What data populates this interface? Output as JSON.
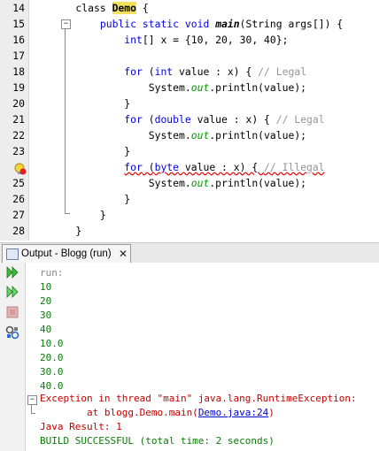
{
  "editor": {
    "lines": [
      {
        "n": "14",
        "parts": [
          [
            "",
            "    class "
          ],
          [
            "hl",
            "Demo"
          ],
          [
            "",
            " {"
          ]
        ]
      },
      {
        "n": "15",
        "parts": [
          [
            "",
            "        "
          ],
          [
            "kw",
            "public static void "
          ],
          [
            "b",
            "main"
          ],
          [
            "",
            "(String args[]) {"
          ]
        ]
      },
      {
        "n": "16",
        "parts": [
          [
            "",
            "            "
          ],
          [
            "kw",
            "int"
          ],
          [
            "",
            "[] x = {10, 20, 30, 40};"
          ]
        ]
      },
      {
        "n": "17",
        "parts": [
          [
            "",
            ""
          ]
        ]
      },
      {
        "n": "18",
        "parts": [
          [
            "",
            "            "
          ],
          [
            "kw",
            "for"
          ],
          [
            "",
            " ("
          ],
          [
            "kw",
            "int"
          ],
          [
            "",
            " value : x) { "
          ],
          [
            "cm",
            "// Legal"
          ]
        ]
      },
      {
        "n": "19",
        "parts": [
          [
            "",
            "                System."
          ],
          [
            "it",
            "out"
          ],
          [
            "",
            ".println(value);"
          ]
        ]
      },
      {
        "n": "20",
        "parts": [
          [
            "",
            "            }"
          ]
        ]
      },
      {
        "n": "21",
        "parts": [
          [
            "",
            "            "
          ],
          [
            "kw",
            "for"
          ],
          [
            "",
            " ("
          ],
          [
            "kw",
            "double"
          ],
          [
            "",
            " value : x) { "
          ],
          [
            "cm",
            "// Legal"
          ]
        ]
      },
      {
        "n": "22",
        "parts": [
          [
            "",
            "                System."
          ],
          [
            "it",
            "out"
          ],
          [
            "",
            ".println(value);"
          ]
        ]
      },
      {
        "n": "23",
        "parts": [
          [
            "",
            "            }"
          ]
        ]
      },
      {
        "n": "",
        "parts": [
          [
            "",
            "            "
          ],
          [
            "kw err",
            "for"
          ],
          [
            "err",
            " ("
          ],
          [
            "kw err",
            "byte"
          ],
          [
            "err",
            " value : x) { "
          ],
          [
            "cm err",
            "// Illegal"
          ]
        ]
      },
      {
        "n": "25",
        "parts": [
          [
            "",
            "                System."
          ],
          [
            "it",
            "out"
          ],
          [
            "",
            ".println(value);"
          ]
        ]
      },
      {
        "n": "26",
        "parts": [
          [
            "",
            "            }"
          ]
        ]
      },
      {
        "n": "27",
        "parts": [
          [
            "",
            "        }"
          ]
        ]
      },
      {
        "n": "28",
        "parts": [
          [
            "",
            "    }"
          ]
        ]
      }
    ]
  },
  "output_tab": {
    "label": "Output - Blogg (run)",
    "close": "✕"
  },
  "toolbar": {
    "icons": [
      "rerun-icon",
      "rerun-with-options-icon",
      "stop-icon",
      "settings-icon"
    ]
  },
  "output": {
    "run": "run:",
    "values": [
      "10",
      "20",
      "30",
      "40",
      "10.0",
      "20.0",
      "30.0",
      "40.0"
    ],
    "exception": "Exception in thread \"main\" java.lang.RuntimeException:",
    "at_prefix": "        at blogg.Demo.main(",
    "at_link": "Demo.java:24",
    "at_suffix": ")",
    "java_result": "Java Result: 1",
    "build": "BUILD SUCCESSFUL (total time: 2 seconds)"
  },
  "colors": {
    "keyword": "#0000e6",
    "comment": "#969696",
    "highlight": "#f4e05f",
    "error": "#c40000",
    "success": "#0a7a0a"
  }
}
